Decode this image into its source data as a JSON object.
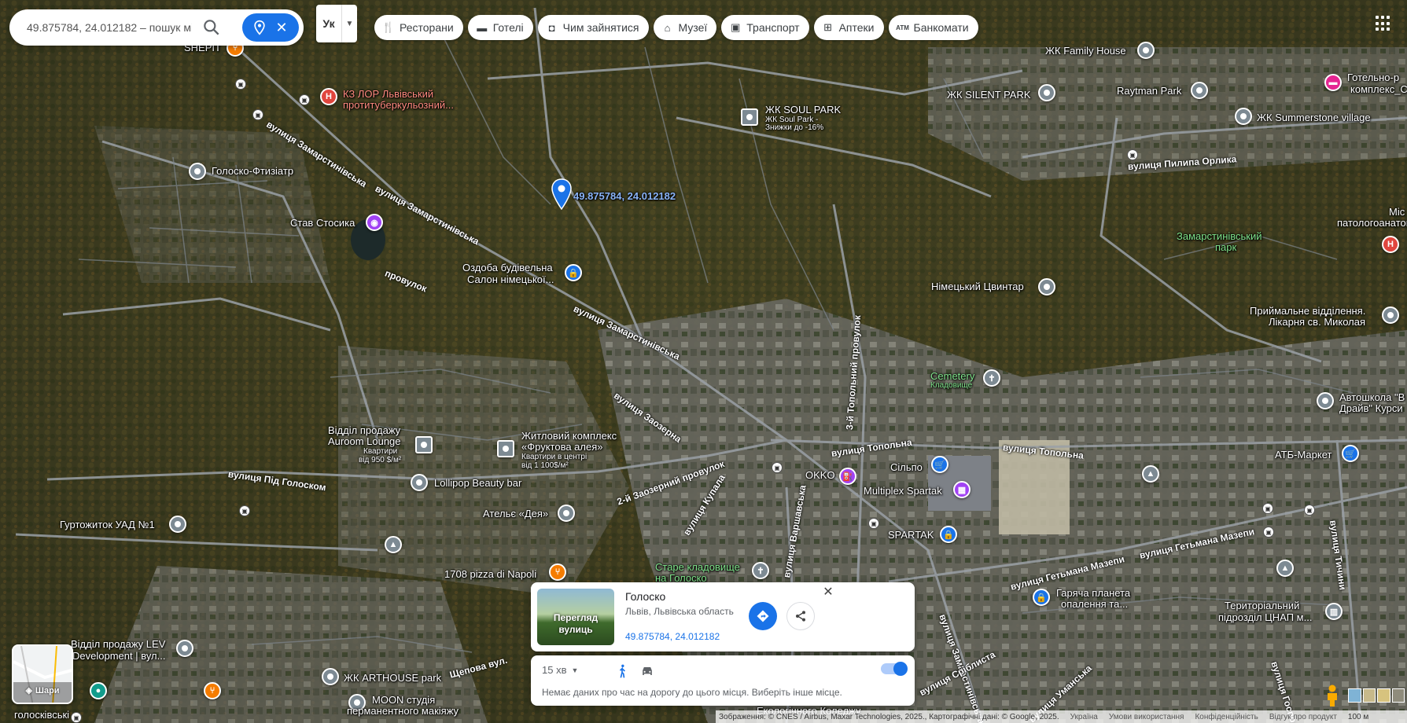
{
  "search": {
    "value": "49.875784, 24.012182 – пошук мі",
    "placeholder": ""
  },
  "lang_label": "Ук",
  "chips": [
    {
      "label": "Ресторани",
      "icon": "fork-knife-icon"
    },
    {
      "label": "Готелі",
      "icon": "bed-icon"
    },
    {
      "label": "Чим зайнятися",
      "icon": "camera-icon"
    },
    {
      "label": "Музеї",
      "icon": "museum-icon"
    },
    {
      "label": "Транспорт",
      "icon": "train-icon"
    },
    {
      "label": "Аптеки",
      "icon": "pharmacy-icon"
    },
    {
      "label": "Банкомати",
      "icon": "atm-icon"
    }
  ],
  "map": {
    "dropped_pin_label": "49.875784, 24.012182",
    "places": {
      "sheptr": "SHEPIT",
      "kz_lor_1": "КЗ ЛОР Львівський",
      "kz_lor_2": "протитуберкульозний...",
      "golosko_ftiz": "Голоско-Фтизіатр",
      "stav": "Став Стосика",
      "ozdoba_1": "Оздоба будівельна",
      "ozdoba_2": "Салон німецької...",
      "soul_park": "ЖК SOUL PARK",
      "soul_park_sub1": "ЖК Soul Park -",
      "soul_park_sub2": "Знижки до -16%",
      "family_house": "ЖК Family House",
      "silent_park": "ЖК SILENT PARK",
      "raytman": "Raytman Park",
      "hotel_1": "Готельно-р",
      "hotel_2": "комплекс_С",
      "summerstone": "ЖК Summerstone village",
      "zamarst_park_1": "Замарстинівський",
      "zamarst_park_2": "парк",
      "mis_1": "Міс",
      "mis_2": "патологоанатоміч",
      "nimetskyi": "Німецький Цвинтар",
      "pryimalne_1": "Приймальне відділення.",
      "pryimalne_2": "Лікарня св. Миколая",
      "cemetery": "Cemetery",
      "cemetery_sub": "Кладовище",
      "avtoshkola_1": "Автошкола \"В",
      "avtoshkola_2": "Драйв\" Курси",
      "atb": "АТБ-Маркет",
      "viddil_auroom_1": "Відділ продажу",
      "viddil_auroom_2": "Auroom Lounge",
      "viddil_auroom_3": "Квартири",
      "viddil_auroom_4": "від 950 $/м²",
      "fruktova_1": "Житловий комплекс",
      "fruktova_2": "«Фруктова алея»",
      "fruktova_3": "Квартири в центрі",
      "fruktova_4": "від 1 100$/м²",
      "lollipop": "Lollipop Beauty bar",
      "okko": "OKKO",
      "silpo": "Сільпо",
      "multiplex": "Multiplex Spartak",
      "spartak": "SPARTAK",
      "hurtozhytok": "Гуртожиток УАД №1",
      "atelie": "Ательє «Дея»",
      "pizza": "1708 pizza di Napoli",
      "stare_1": "Старе кладовище",
      "stare_2": "на Голоско",
      "goriacha_1": "Гаряча планета",
      "goriacha_2": "опалення та...",
      "terytorialnyi_1": "Територіальний",
      "terytorialnyi_2": "підрозділ ЦНАП м...",
      "lev_1": "Відділ продажу LEV",
      "lev_2": "Development | вул...",
      "arthouse": "ЖК ARTHOUSE park",
      "moon_1": "MOON студія",
      "moon_2": "перманентного макіяжу",
      "holoskivskyi": "голосківські",
      "ekolog": "Екологічного Коледжу"
    },
    "streets": {
      "zamarst_1": "вулиця Замарстинівська",
      "zamarst_2": "вулиця Замарстинівська",
      "zamarst_3": "вулиця Замарстинівська",
      "zamarst_4": "вулиця Замарстинівська",
      "provulok": "провулок",
      "zaozerna": "вулиця Заозерна",
      "topolna_1": "вулиця Топольна",
      "topolna_2": "вулиця Топольна",
      "pid_goloskom": "вулиця Під Голоском",
      "zaozernyi_prov": "2-й Заозерний провулок",
      "kupala": "вулиця Купала",
      "varshavska": "вулиця Варшавська",
      "topolnyi_prov": "3-й Топольний провулок",
      "mazepy_1": "вулиця Гетьмана Мазепи",
      "mazepy_2": "вулиця Гетьмана Мазепи",
      "mazepy_3": "вулиця Гетьмана Мазепи",
      "orlyka": "вулиця Пилипа Орлика",
      "tychyny": "вулиця Тичини",
      "shchepova": "Щепова вул.",
      "umanska": "вулиця Уманська",
      "sribliasta": "вулиця Сріблиста",
      "gospitalna": "вулиця Господ"
    }
  },
  "card": {
    "thumb_label_1": "Перегляд",
    "thumb_label_2": "вулиць",
    "name": "Голоско",
    "region": "Львів, Львівська область",
    "coords": "49.875784, 24.012182"
  },
  "travel": {
    "time": "15 хв",
    "message": "Немає даних про час на дорогу до цього місця. Виберіть інше місце."
  },
  "layers_label": "Шари",
  "footer": {
    "imagery": "Зображення: © CNES / Airbus, Maxar Technologies, 2025., Картографічні дані: © Google, 2025.",
    "country": "Україна",
    "terms": "Умови використання",
    "privacy": "Конфіденційність",
    "feedback": "Відгук про продукт",
    "scale": "100 м"
  },
  "colors": {
    "accent": "#1a73e8",
    "chip_bg": "#ffffff",
    "map_dark": "#2f3524"
  }
}
